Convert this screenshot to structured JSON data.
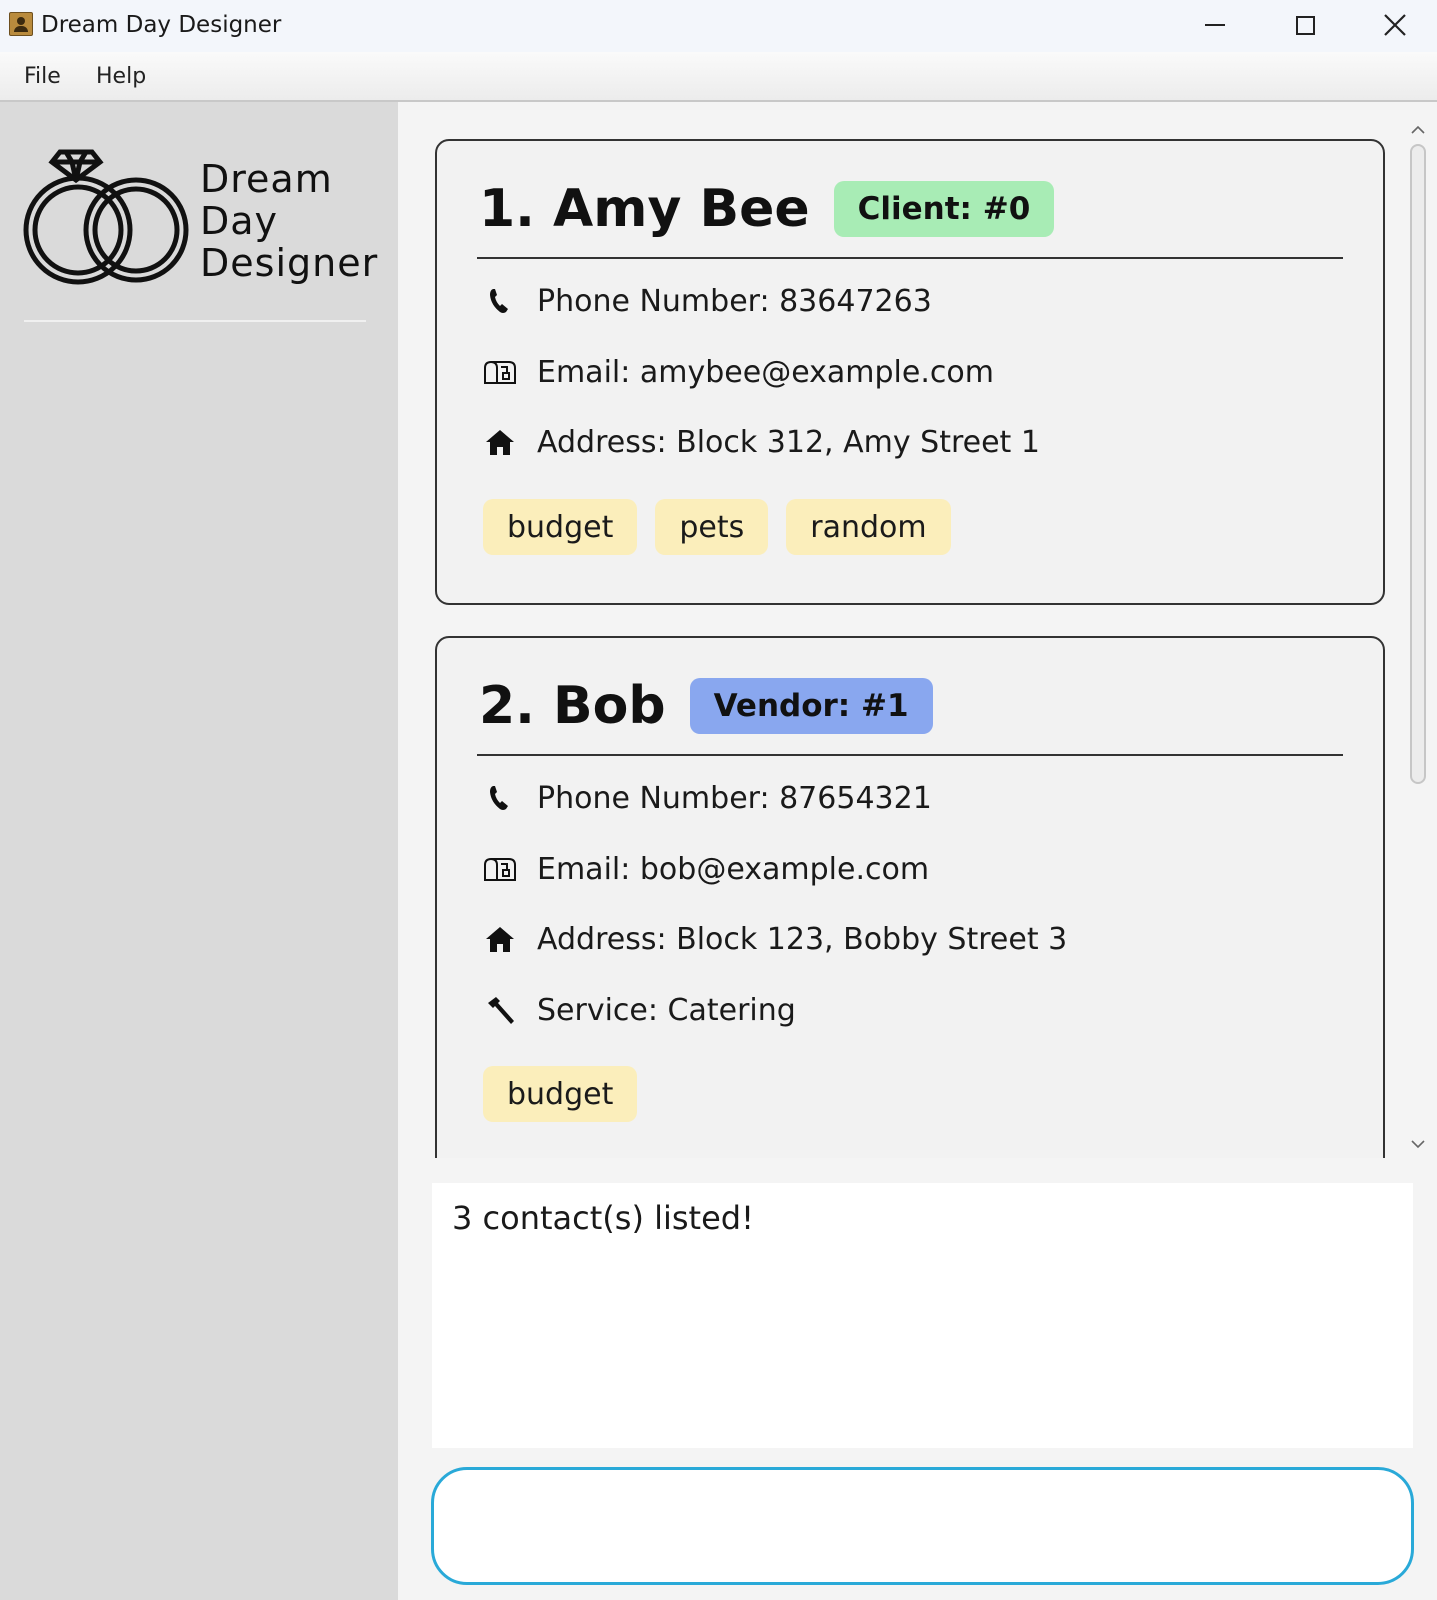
{
  "window": {
    "title": "Dream Day Designer",
    "icon": "address-book-icon"
  },
  "menu": {
    "file": "File",
    "help": "Help"
  },
  "sidebar": {
    "logo_lines": [
      "Dream",
      "Day",
      "Designer"
    ]
  },
  "contacts": [
    {
      "name": "1. Amy Bee",
      "role_badge": "Client: #0",
      "badge_color": "#a8ecb5",
      "phone": "Phone Number: 83647263",
      "email": "Email: amybee@example.com",
      "address": "Address: Block 312, Amy Street 1",
      "tags": [
        "budget",
        "pets",
        "random"
      ]
    },
    {
      "name": "2. Bob",
      "role_badge": "Vendor: #1",
      "badge_color": "#89a7ef",
      "phone": "Phone Number: 87654321",
      "email": "Email: bob@example.com",
      "address": "Address: Block 123, Bobby Street 3",
      "service": "Service: Catering",
      "tags": [
        "budget"
      ]
    }
  ],
  "result": {
    "text": "3 contact(s) listed!"
  },
  "command": {
    "value": "",
    "placeholder": ""
  },
  "colors": {
    "tag": "#fbeebb",
    "command_border": "#29a9d8",
    "sidebar_bg": "#dadada"
  }
}
